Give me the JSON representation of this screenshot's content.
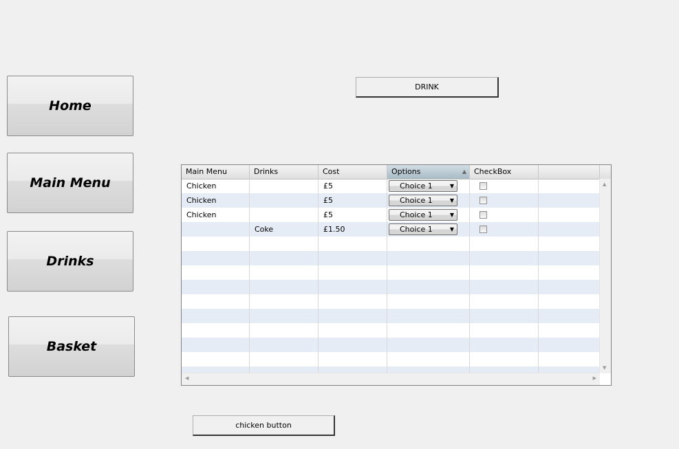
{
  "nav": {
    "home": "Home",
    "main_menu": "Main Menu",
    "drinks": "Drinks",
    "basket": "Basket"
  },
  "drink_button": "DRINK",
  "chicken_button": "chicken button",
  "table": {
    "columns": [
      "Main Menu",
      "Drinks",
      "Cost",
      "Options",
      "CheckBox"
    ],
    "sorted_column": "Options",
    "rows": [
      {
        "main": "Chicken",
        "drink": "",
        "cost": "£5",
        "option": "Choice 1",
        "checked": false
      },
      {
        "main": "Chicken",
        "drink": "",
        "cost": "£5",
        "option": "Choice 1",
        "checked": false
      },
      {
        "main": "Chicken",
        "drink": "",
        "cost": "£5",
        "option": "Choice 1",
        "checked": false
      },
      {
        "main": "",
        "drink": "Coke",
        "cost": "£1.50",
        "option": "Choice 1",
        "checked": false
      }
    ]
  }
}
